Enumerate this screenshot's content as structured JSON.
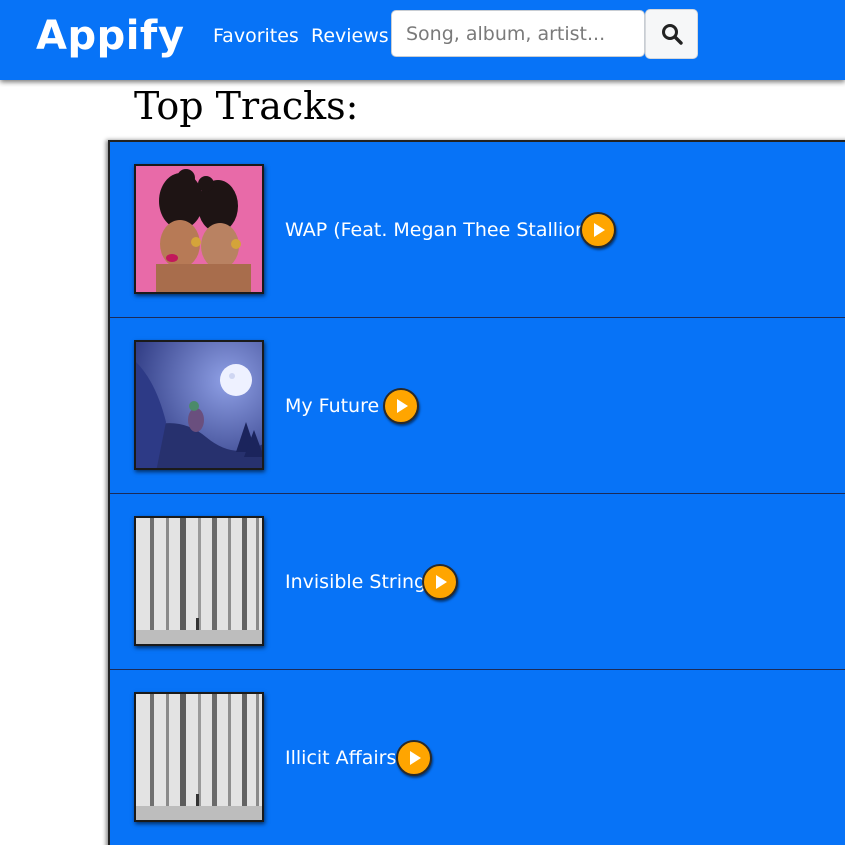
{
  "app": {
    "brand": "Appify"
  },
  "nav": {
    "favorites": "Favorites",
    "reviews": "Reviews"
  },
  "search": {
    "placeholder": "Song, album, artist...",
    "button_icon": "search-icon"
  },
  "page": {
    "heading": "Top Tracks:"
  },
  "colors": {
    "primary": "#0773f7",
    "play": "#ffa500",
    "text_light": "#ffffff"
  },
  "tracks": [
    {
      "title": "WAP (Feat. Megan Thee Stallion)",
      "cover_icon": "album-cover"
    },
    {
      "title": "My Future",
      "cover_icon": "album-cover"
    },
    {
      "title": "Invisible String",
      "cover_icon": "album-cover"
    },
    {
      "title": "Illicit Affairs",
      "cover_icon": "album-cover"
    }
  ]
}
